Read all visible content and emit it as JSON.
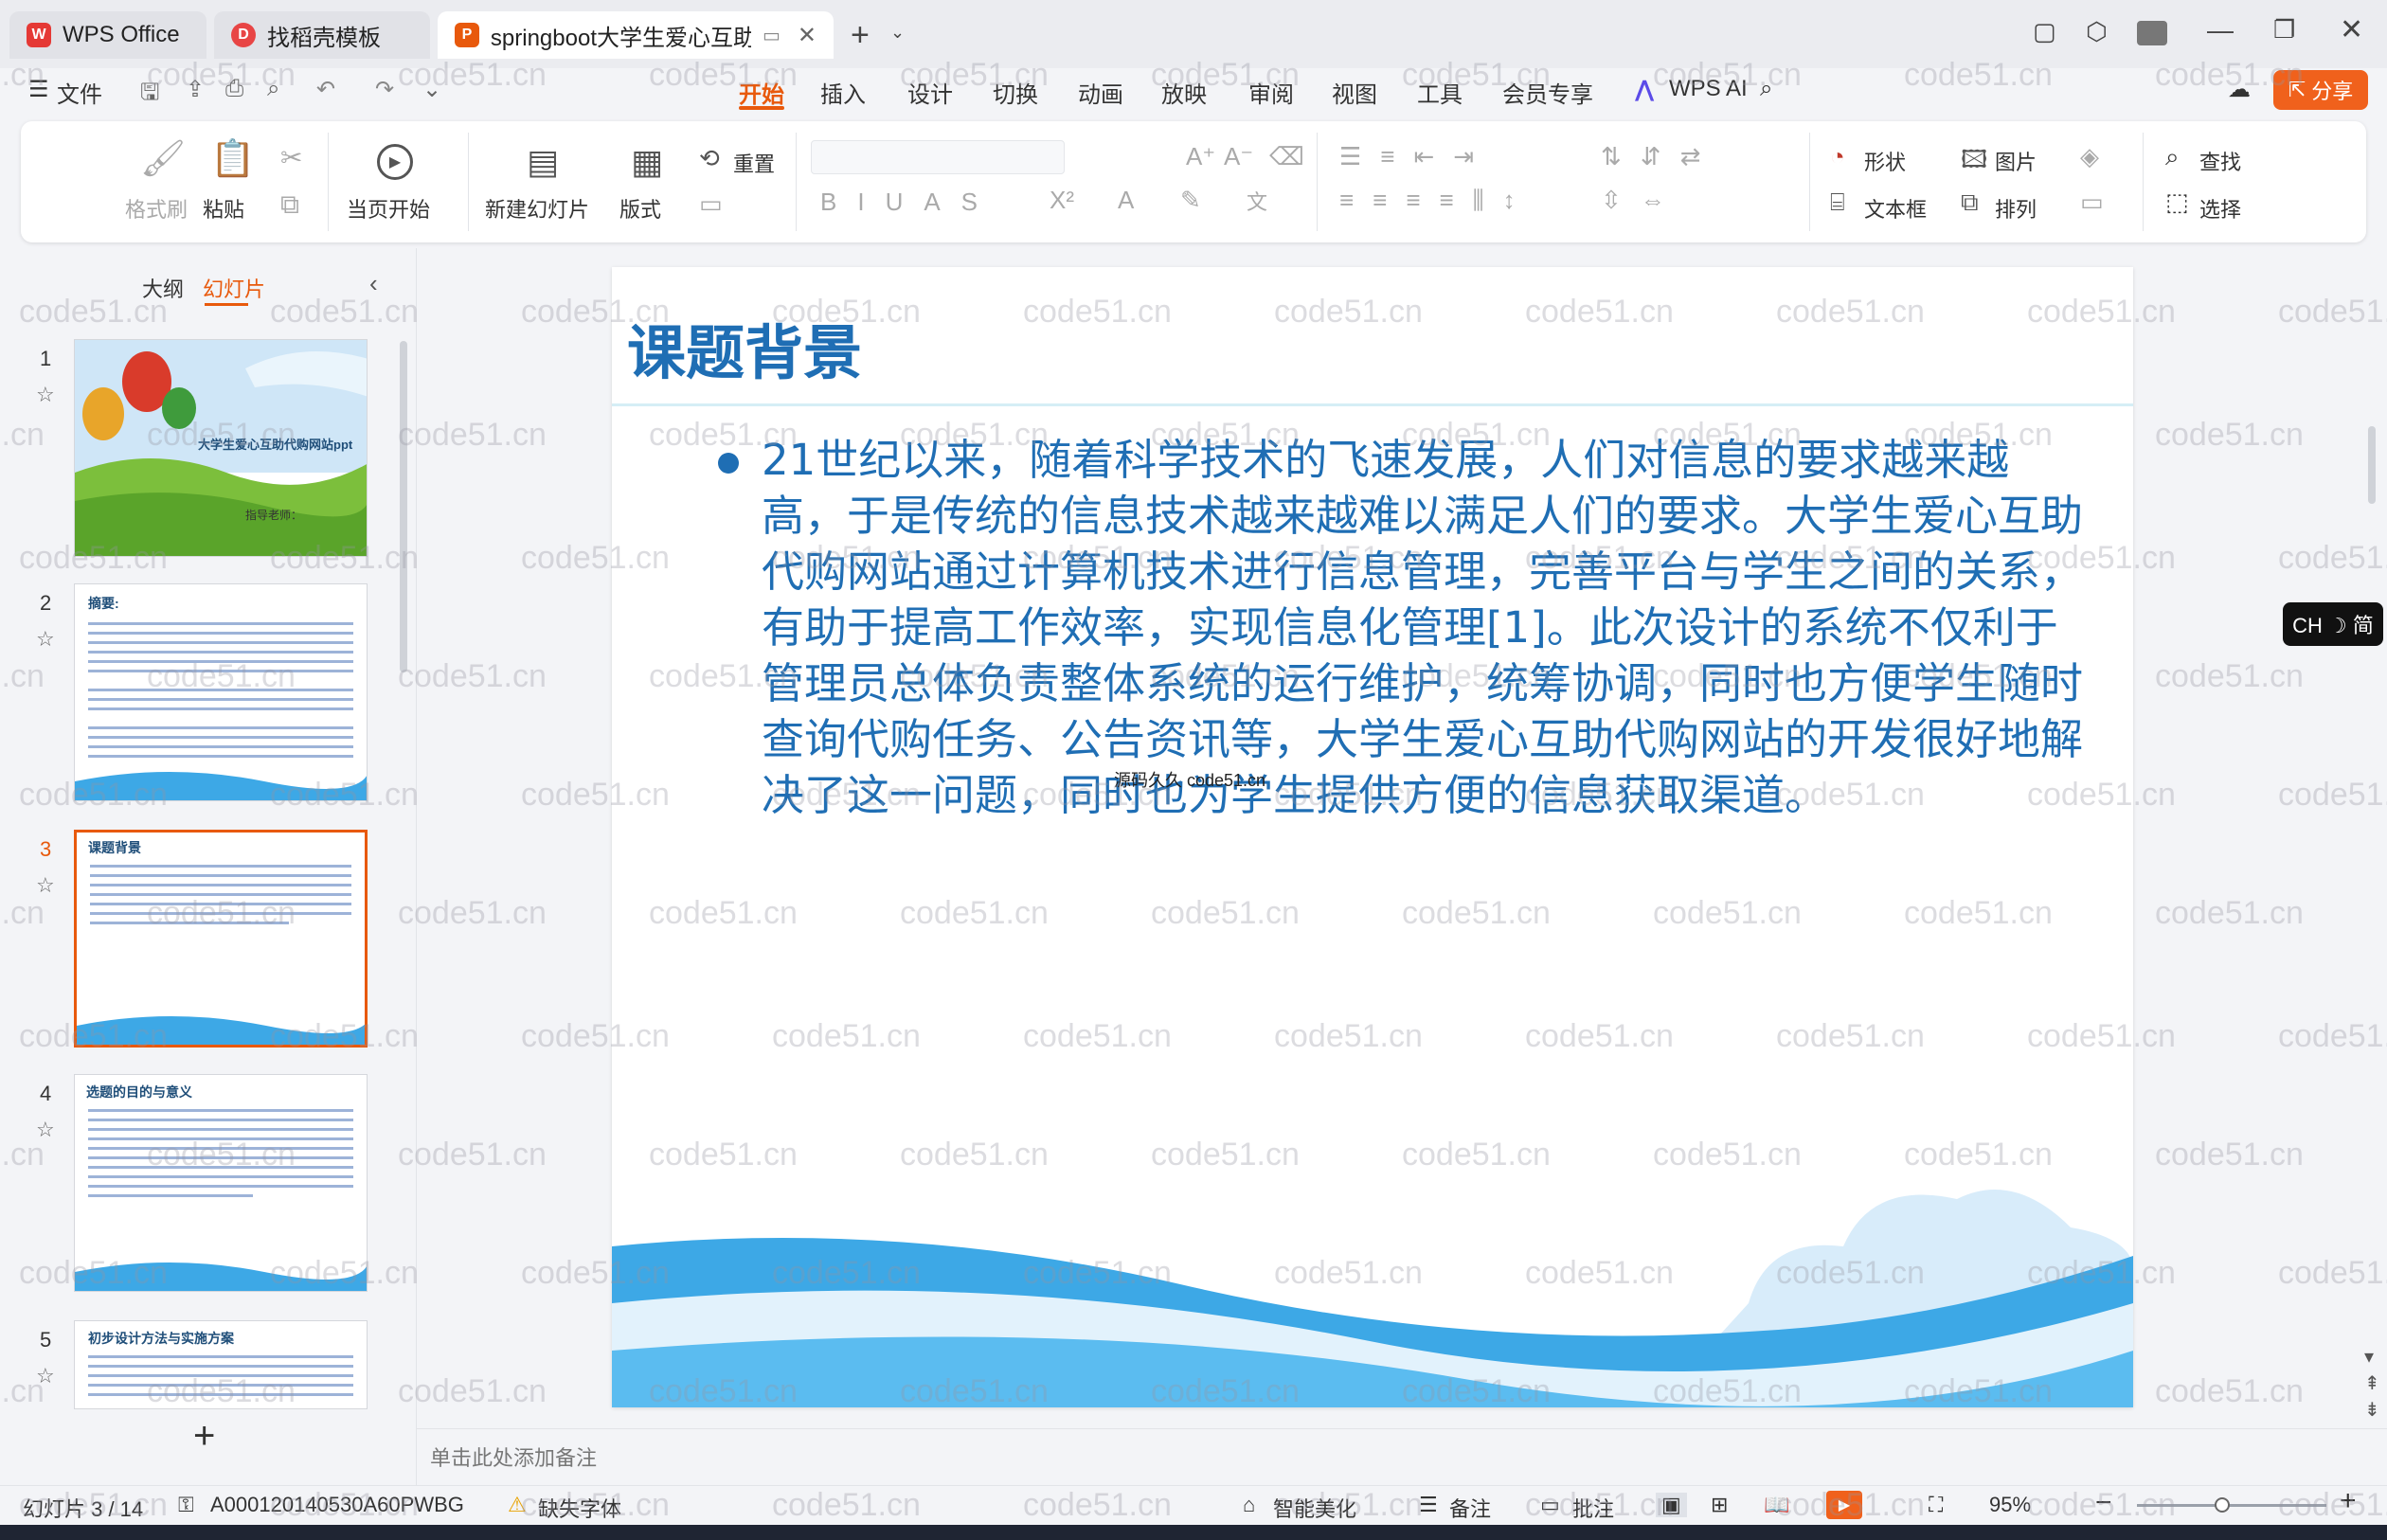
{
  "tabs": {
    "wps": "WPS Office",
    "template": "找稻壳模板",
    "doc": "springboot大学生爱心互助代"
  },
  "menu": {
    "file": "文件",
    "items": [
      "开始",
      "插入",
      "设计",
      "切换",
      "动画",
      "放映",
      "审阅",
      "视图",
      "工具",
      "会员专享"
    ],
    "active": "开始",
    "ai": "WPS AI",
    "share": "分享"
  },
  "ribbon": {
    "format_painter": "格式刷",
    "paste": "粘贴",
    "play": "当页开始",
    "new_slide": "新建幻灯片",
    "layout": "版式",
    "reset": "重置",
    "shape": "形状",
    "picture": "图片",
    "textbox": "文本框",
    "arrange": "排列",
    "find": "查找",
    "select": "选择"
  },
  "panel": {
    "outline_tab": "大纲",
    "slides_tab": "幻灯片",
    "add_icon": "plus-icon"
  },
  "thumbnails": [
    {
      "num": "1",
      "title": "大学生爱心互助代购网站ppt",
      "sub": "指导老师："
    },
    {
      "num": "2",
      "title": "摘要:"
    },
    {
      "num": "3",
      "title": "课题背景"
    },
    {
      "num": "4",
      "title": "选题的目的与意义"
    },
    {
      "num": "5",
      "title": "初步设计方法与实施方案"
    }
  ],
  "slide": {
    "title": "课题背景",
    "body": "21世纪以来，随着科学技术的飞速发展，人们对信息的要求越来越高，于是传统的信息技术越来越难以满足人们的要求。大学生爱心互助代购网站通过计算机技术进行信息管理，完善平台与学生之间的关系，有助于提高工作效率，实现信息化管理[1]。此次设计的系统不仅利于管理员总体负责整体系统的运行维护，统筹协调，同时也方便学生随时查询代购任务、公告资讯等，大学生爱心互助代购网站的开发很好地解决了这一问题，同时也为学生提供方便的信息获取渠道。",
    "overlay": "源码久久 code51.cn"
  },
  "notes": "单击此处添加备注",
  "ime": "CH ☽ 简",
  "status": {
    "slide_counter": "幻灯片 3 / 14",
    "doc_id": "A000120140530A60PWBG",
    "missing_font": "缺失字体",
    "beautify": "智能美化",
    "notes": "备注",
    "comments": "批注",
    "zoom": "95%"
  },
  "watermark": "code51.cn",
  "colors": {
    "accent": "#e8590c",
    "slide_text": "#1f6eb4",
    "share_btn": "#f0611c",
    "wave": "#3da8e6"
  }
}
